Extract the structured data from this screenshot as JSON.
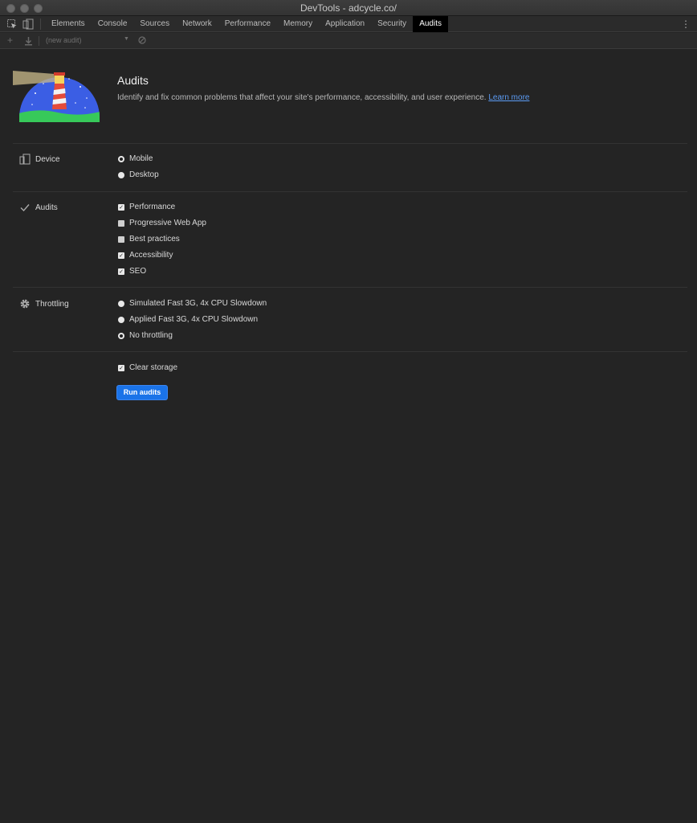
{
  "window": {
    "title": "DevTools - adcycle.co/"
  },
  "tabs": [
    {
      "label": "Elements"
    },
    {
      "label": "Console"
    },
    {
      "label": "Sources"
    },
    {
      "label": "Network"
    },
    {
      "label": "Performance"
    },
    {
      "label": "Memory"
    },
    {
      "label": "Application"
    },
    {
      "label": "Security"
    },
    {
      "label": "Audits"
    }
  ],
  "toolbar": {
    "select_value": "(new audit)"
  },
  "header": {
    "title": "Audits",
    "description": "Identify and fix common problems that affect your site's performance, accessibility, and user experience.",
    "link": "Learn more"
  },
  "device": {
    "label": "Device",
    "options": [
      {
        "label": "Mobile",
        "selected": true
      },
      {
        "label": "Desktop",
        "selected": false
      }
    ]
  },
  "audits": {
    "label": "Audits",
    "options": [
      {
        "label": "Performance",
        "checked": true
      },
      {
        "label": "Progressive Web App",
        "checked": false
      },
      {
        "label": "Best practices",
        "checked": false
      },
      {
        "label": "Accessibility",
        "checked": true
      },
      {
        "label": "SEO",
        "checked": true
      }
    ]
  },
  "throttling": {
    "label": "Throttling",
    "options": [
      {
        "label": "Simulated Fast 3G, 4x CPU Slowdown",
        "selected": false
      },
      {
        "label": "Applied Fast 3G, 4x CPU Slowdown",
        "selected": false
      },
      {
        "label": "No throttling",
        "selected": true
      }
    ]
  },
  "storage": {
    "label": "Clear storage",
    "checked": true
  },
  "run_button": {
    "label": "Run audits"
  },
  "colors": {
    "accent": "#1a73e8",
    "link": "#5c9cf5",
    "background": "#242424"
  }
}
